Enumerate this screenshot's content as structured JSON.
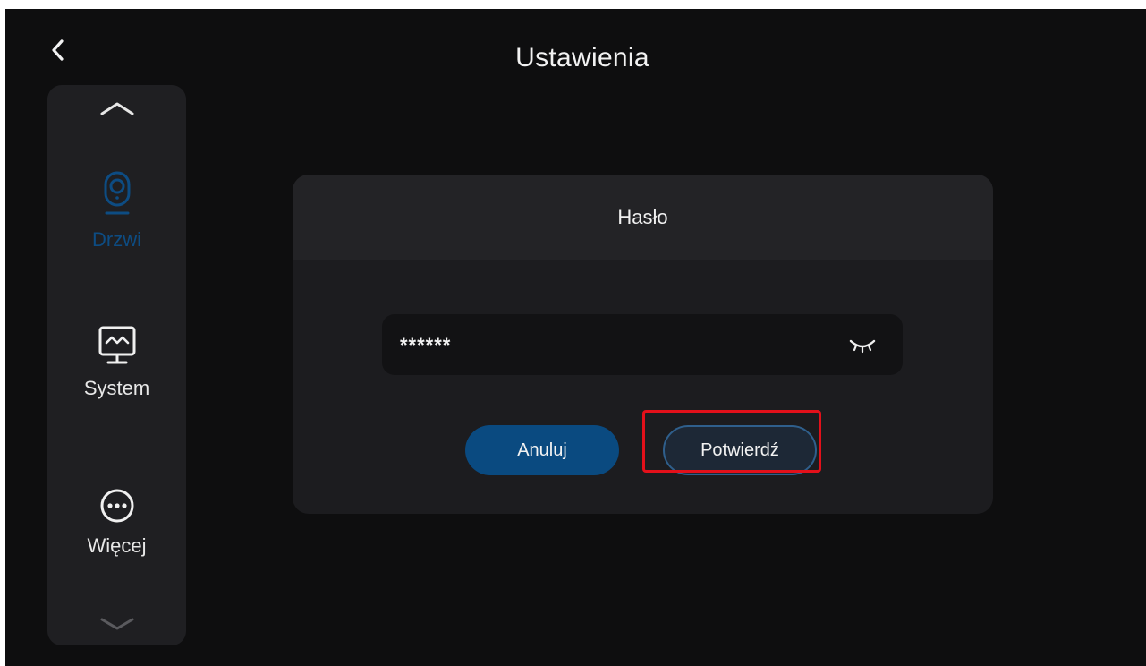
{
  "header": {
    "title": "Ustawienia",
    "back_icon": "chevron-left-icon"
  },
  "sidebar": {
    "scroll_up_icon": "chevron-up-icon",
    "scroll_down_icon": "chevron-down-icon",
    "items": [
      {
        "label": "Drzwi",
        "icon": "door-camera-icon",
        "active": true
      },
      {
        "label": "System",
        "icon": "monitor-icon",
        "active": false
      },
      {
        "label": "Więcej",
        "icon": "more-dots-icon",
        "active": false
      }
    ]
  },
  "dialog": {
    "title": "Hasło",
    "password_value": "******",
    "visibility_icon": "eye-closed-icon",
    "cancel_label": "Anuluj",
    "confirm_label": "Potwierdź"
  },
  "colors": {
    "background": "#0e0e0f",
    "sidebar": "#1f1f22",
    "dialog": "#1c1c1f",
    "accent_blue": "#0a4a80",
    "active_label": "#0d4c83",
    "highlight": "#e3101a"
  }
}
